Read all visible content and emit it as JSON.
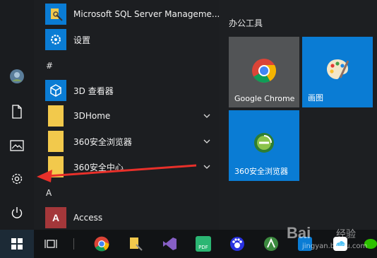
{
  "rail": {
    "items": [
      "user-avatar",
      "documents",
      "pictures",
      "settings",
      "power"
    ]
  },
  "apps": [
    {
      "label": "Microsoft SQL Server Manageme...",
      "icon": "sql-server-icon",
      "color": "#0a7cd4"
    },
    {
      "label": "设置",
      "icon": "gear-icon",
      "color": "#0a7cd4"
    },
    {
      "letter": "#"
    },
    {
      "label": "3D 查看器",
      "icon": "cube-3d-icon",
      "color": "#0a7cd4"
    },
    {
      "label": "3DHome",
      "icon": "folder-icon",
      "color": "#f2c94c",
      "expandable": true
    },
    {
      "label": "360安全浏览器",
      "icon": "folder-icon",
      "color": "#f2c94c",
      "expandable": true
    },
    {
      "label": "360安全中心",
      "icon": "folder-icon",
      "color": "#f2c94c",
      "expandable": true
    },
    {
      "letter": "A"
    },
    {
      "label": "Access",
      "icon": "access-icon",
      "color": "#a4373a"
    }
  ],
  "tiles": {
    "group_title": "办公工具",
    "items": [
      {
        "label": "Google Chrome",
        "bg": "#525456"
      },
      {
        "label": "画图",
        "bg": "#0a7cd4"
      },
      {
        "label": "360安全浏览器",
        "bg": "#0a7cd4"
      }
    ]
  },
  "watermark": {
    "logo": "Bai",
    "text": "经验",
    "url": "jingyan.baidu.com"
  },
  "colors": {
    "accent": "#0a7cd4",
    "arrow": "#e8302a"
  }
}
